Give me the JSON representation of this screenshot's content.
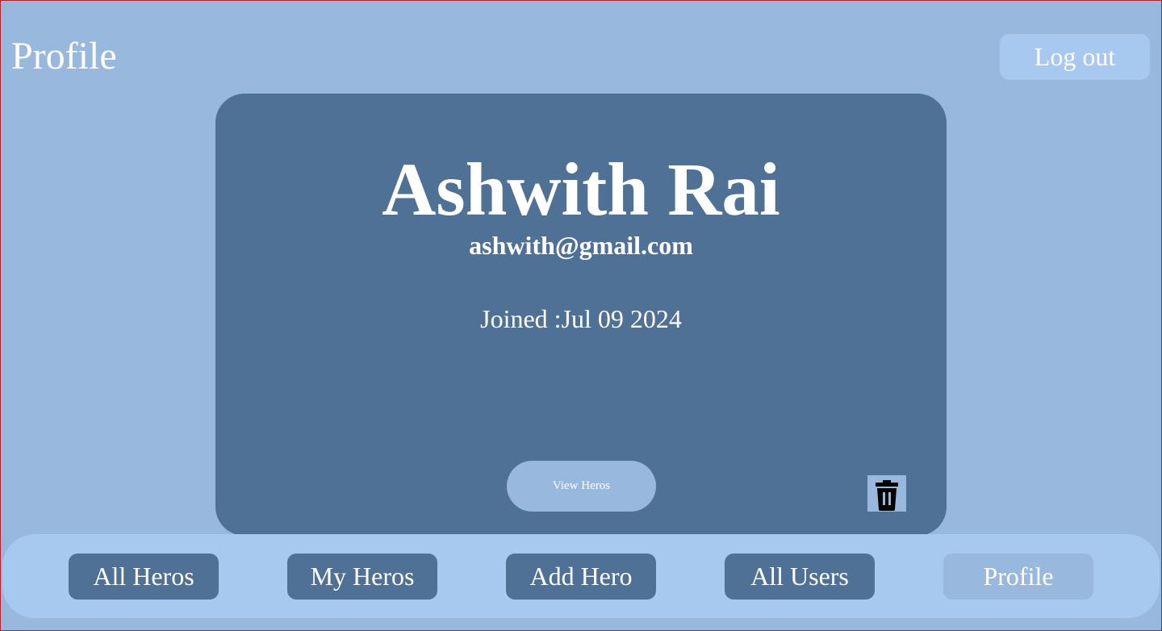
{
  "header": {
    "title": "Profile",
    "logout_label": "Log out"
  },
  "profile": {
    "name": "Ashwith Rai",
    "email": "ashwith@gmail.com",
    "joined_text": "Joined :Jul 09 2024",
    "view_heros_label": "View Heros",
    "delete_icon": "trash-icon"
  },
  "nav": {
    "items": [
      {
        "label": "All Heros",
        "active": false
      },
      {
        "label": "My Heros",
        "active": false
      },
      {
        "label": "Add Hero",
        "active": false
      },
      {
        "label": "All Users",
        "active": false
      },
      {
        "label": "Profile",
        "active": true
      }
    ]
  },
  "colors": {
    "page_background": "#98b8de",
    "card_background": "#507196",
    "nav_bar_background": "#a7c8ef",
    "button_dark": "#507196",
    "button_active": "#98b8de",
    "text": "#ffffff"
  }
}
